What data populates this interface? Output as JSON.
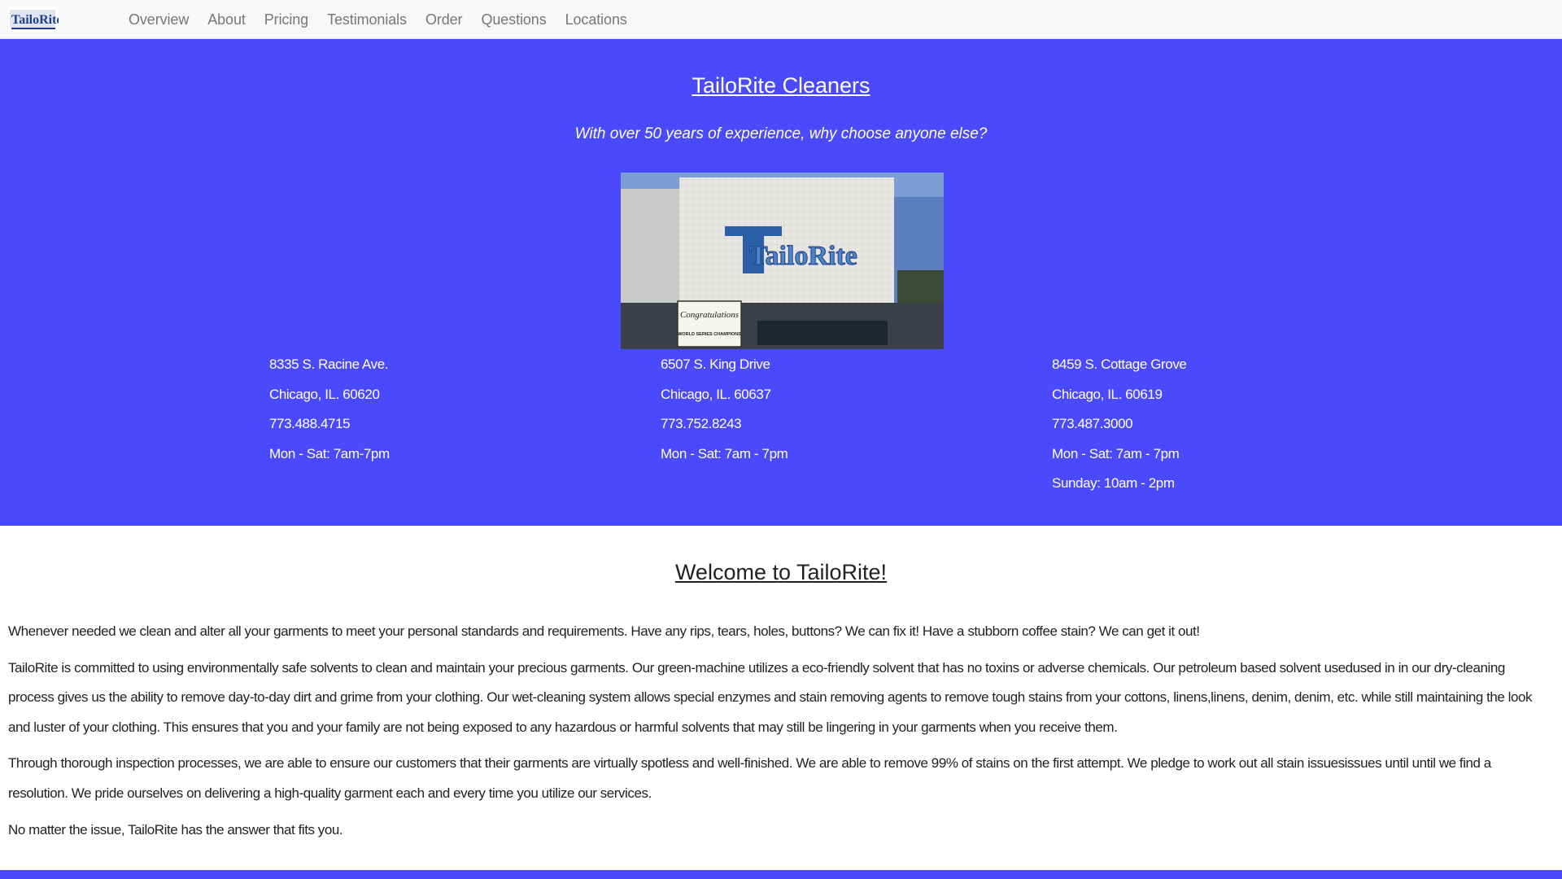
{
  "nav": {
    "logo_text": "TailoRite",
    "links": [
      "Overview",
      "About",
      "Pricing",
      "Testimonials",
      "Order",
      "Questions",
      "Locations"
    ]
  },
  "hero": {
    "title": "TailoRite Cleaners",
    "tagline": "With over 50 years of experience, why choose anyone else?",
    "photo_sign": "TailoRite",
    "photo_banner": "Congratulations",
    "photo_banner_sub": "WORLD SERIES CHAMPIONS",
    "colors": {
      "background": "#4a4afc"
    }
  },
  "locations": [
    {
      "street": "8335 S. Racine Ave.",
      "city": "Chicago, IL. 60620",
      "phone": "773.488.4715",
      "hours": "Mon - Sat: 7am-7pm"
    },
    {
      "street": "6507 S. King Drive",
      "city": "Chicago, IL. 60637",
      "phone": "773.752.8243",
      "hours": "Mon - Sat: 7am - 7pm"
    },
    {
      "street": "8459 S. Cottage Grove",
      "city": "Chicago, IL. 60619",
      "phone": "773.487.3000",
      "hours": "Mon - Sat: 7am - 7pm",
      "hours2": "Sunday: 10am - 2pm"
    }
  ],
  "welcome": {
    "heading": "Welcome to TailoRite!",
    "paragraphs": [
      "Whenever needed we clean and alter all your garments to meet your personal standards and requirements. Have any rips, tears, holes, buttons? We can fix it! Have a stubborn coffee stain? We can get it out!",
      "TailoRite is committed to using environmentally safe solvents to clean and maintain your precious garments. Our green-machine utilizes a eco-friendly solvent that has no toxins or adverse chemicals. Our petroleum based solvent usedused in in our dry-cleaning process gives us the ability to remove day-to-day dirt and grime from your clothing. Our wet-cleaning system allows special enzymes and stain removing agents to remove tough stains from your cottons, linens,linens, denim, denim, etc. while still maintaining the look and luster of your clothing. This ensures that you and your family are not being exposed to any hazardous or harmful solvents that may still be lingering in your garments when you receive them.",
      "Through thorough inspection processes, we are able to ensure our customers that their garments are virtually spotless and well-finished. We are able to remove 99% of stains on the first attempt. We pledge to work out all stain issuesissues until until we find a resolution. We pride ourselves on delivering a high-quality garment each and every time you utilize our services.",
      "No matter the issue, TailoRite has the answer that fits you."
    ]
  }
}
